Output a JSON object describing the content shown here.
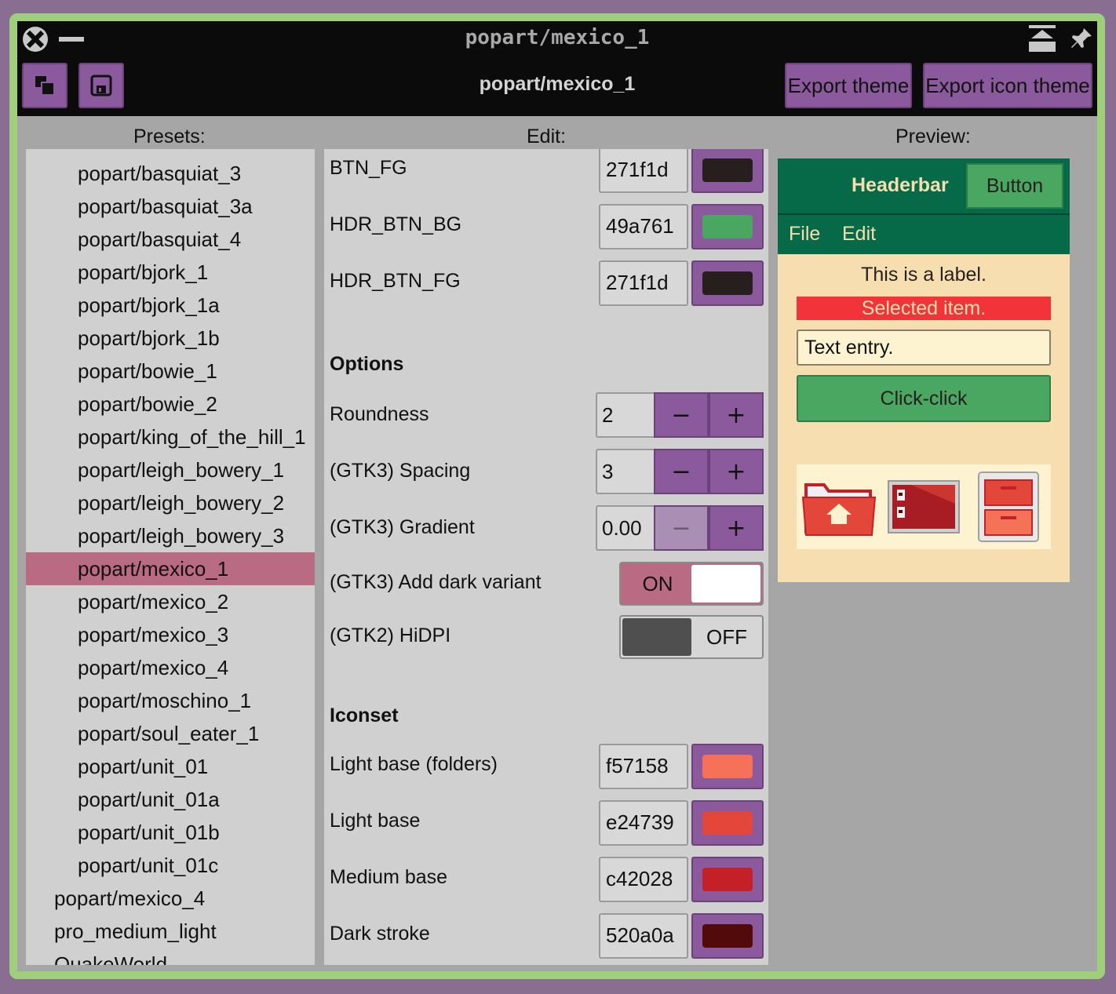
{
  "window": {
    "title": "popart/mexico_1",
    "header_title": "popart/mexico_1",
    "export_theme": "Export theme",
    "export_icon_theme": "Export icon theme"
  },
  "columns": {
    "presets": "Presets:",
    "edit": "Edit:",
    "preview": "Preview:"
  },
  "presets": {
    "items": [
      {
        "label": "popart/basquiat_3",
        "indent": 1
      },
      {
        "label": "popart/basquiat_3a",
        "indent": 1
      },
      {
        "label": "popart/basquiat_4",
        "indent": 1
      },
      {
        "label": "popart/bjork_1",
        "indent": 1
      },
      {
        "label": "popart/bjork_1a",
        "indent": 1
      },
      {
        "label": "popart/bjork_1b",
        "indent": 1
      },
      {
        "label": "popart/bowie_1",
        "indent": 1
      },
      {
        "label": "popart/bowie_2",
        "indent": 1
      },
      {
        "label": "popart/king_of_the_hill_1",
        "indent": 1
      },
      {
        "label": "popart/leigh_bowery_1",
        "indent": 1
      },
      {
        "label": "popart/leigh_bowery_2",
        "indent": 1
      },
      {
        "label": "popart/leigh_bowery_3",
        "indent": 1
      },
      {
        "label": "popart/mexico_1",
        "indent": 1,
        "selected": true
      },
      {
        "label": "popart/mexico_2",
        "indent": 1
      },
      {
        "label": "popart/mexico_3",
        "indent": 1
      },
      {
        "label": "popart/mexico_4",
        "indent": 1
      },
      {
        "label": "popart/moschino_1",
        "indent": 1
      },
      {
        "label": "popart/soul_eater_1",
        "indent": 1
      },
      {
        "label": "popart/unit_01",
        "indent": 1
      },
      {
        "label": "popart/unit_01a",
        "indent": 1
      },
      {
        "label": "popart/unit_01b",
        "indent": 1
      },
      {
        "label": "popart/unit_01c",
        "indent": 1
      },
      {
        "label": "popart/mexico_4",
        "indent": 0
      },
      {
        "label": "pro_medium_light",
        "indent": 0
      },
      {
        "label": "QuakeWorld",
        "indent": 0
      }
    ]
  },
  "edit": {
    "colors_top": [
      {
        "label": "BTN_FG",
        "value": "271f1d",
        "color": "#271f1d"
      },
      {
        "label": "HDR_BTN_BG",
        "value": "49a761",
        "color": "#49a761"
      },
      {
        "label": "HDR_BTN_FG",
        "value": "271f1d",
        "color": "#271f1d"
      }
    ],
    "options_title": "Options",
    "roundness": {
      "label": "Roundness",
      "value": "2"
    },
    "spacing": {
      "label": "(GTK3) Spacing",
      "value": "3"
    },
    "gradient": {
      "label": "(GTK3) Gradient",
      "value": "0.00"
    },
    "dark_variant": {
      "label": "(GTK3) Add dark variant",
      "state": "ON"
    },
    "hidpi": {
      "label": "(GTK2) HiDPI",
      "state": "OFF"
    },
    "minus": "−",
    "plus": "+",
    "iconset_title": "Iconset",
    "colors_icons": [
      {
        "label": "Light base (folders)",
        "value": "f57158",
        "color": "#f57158"
      },
      {
        "label": "Light base",
        "value": "e24739",
        "color": "#e24739"
      },
      {
        "label": "Medium base",
        "value": "c42028",
        "color": "#c42028"
      },
      {
        "label": "Dark stroke",
        "value": "520a0a",
        "color": "#520a0a"
      }
    ]
  },
  "preview": {
    "headerbar": "Headerbar",
    "button": "Button",
    "menu_file": "File",
    "menu_edit": "Edit",
    "label": "This is a label.",
    "selected": "Selected item.",
    "entry": "Text entry.",
    "click": "Click-click"
  }
}
